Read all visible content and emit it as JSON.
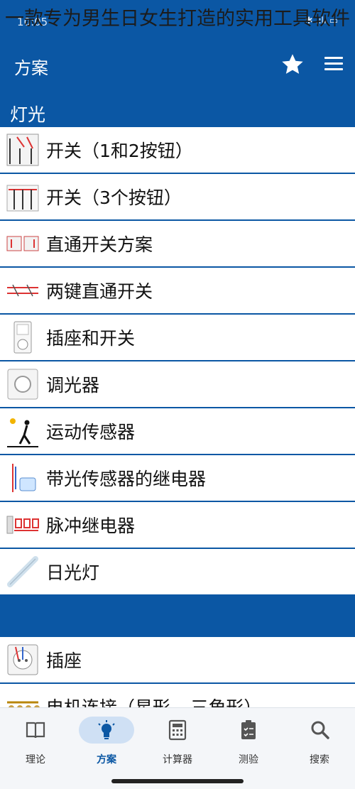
{
  "watermark": "一款专为男生日女生打造的实用工具软件",
  "status_bar": {
    "time": "10:05",
    "icons": "✱ .ıll ▭"
  },
  "app_bar": {
    "title": "方案",
    "star_icon": "star-icon",
    "menu_icon": "hamburger-menu-icon"
  },
  "sections": [
    {
      "title": "灯光",
      "items": [
        {
          "label": "开关（1和2按钮）",
          "icon": "switch-1-2-buttons-diagram"
        },
        {
          "label": "开关（3个按钮）",
          "icon": "switch-3-buttons-diagram"
        },
        {
          "label": "直通开关方案",
          "icon": "pass-through-switch-diagram"
        },
        {
          "label": "两键直通开关",
          "icon": "two-key-pass-through-switch-diagram"
        },
        {
          "label": "插座和开关",
          "icon": "socket-and-switch-icon"
        },
        {
          "label": "调光器",
          "icon": "dimmer-icon"
        },
        {
          "label": "运动传感器",
          "icon": "motion-sensor-icon"
        },
        {
          "label": "带光传感器的继电器",
          "icon": "light-sensor-relay-icon"
        },
        {
          "label": "脉冲继电器",
          "icon": "impulse-relay-icon"
        },
        {
          "label": "日光灯",
          "icon": "fluorescent-tube-icon"
        }
      ]
    },
    {
      "title": "",
      "items": [
        {
          "label": "插座",
          "icon": "power-socket-icon"
        },
        {
          "label": "电机连接（星形 – 三角形）",
          "icon": "motor-connection-icon"
        }
      ]
    }
  ],
  "bottom_nav": {
    "items": [
      {
        "label": "理论",
        "icon": "book-icon",
        "active": false
      },
      {
        "label": "方案",
        "icon": "lightbulb-icon",
        "active": true
      },
      {
        "label": "计算器",
        "icon": "calculator-icon",
        "active": false
      },
      {
        "label": "测验",
        "icon": "quiz-clipboard-icon",
        "active": false
      },
      {
        "label": "搜索",
        "icon": "search-icon",
        "active": false
      }
    ]
  },
  "colors": {
    "primary": "#0b57a4",
    "nav_bg": "#f4f6f9",
    "active_pill": "#cfe0f4"
  }
}
